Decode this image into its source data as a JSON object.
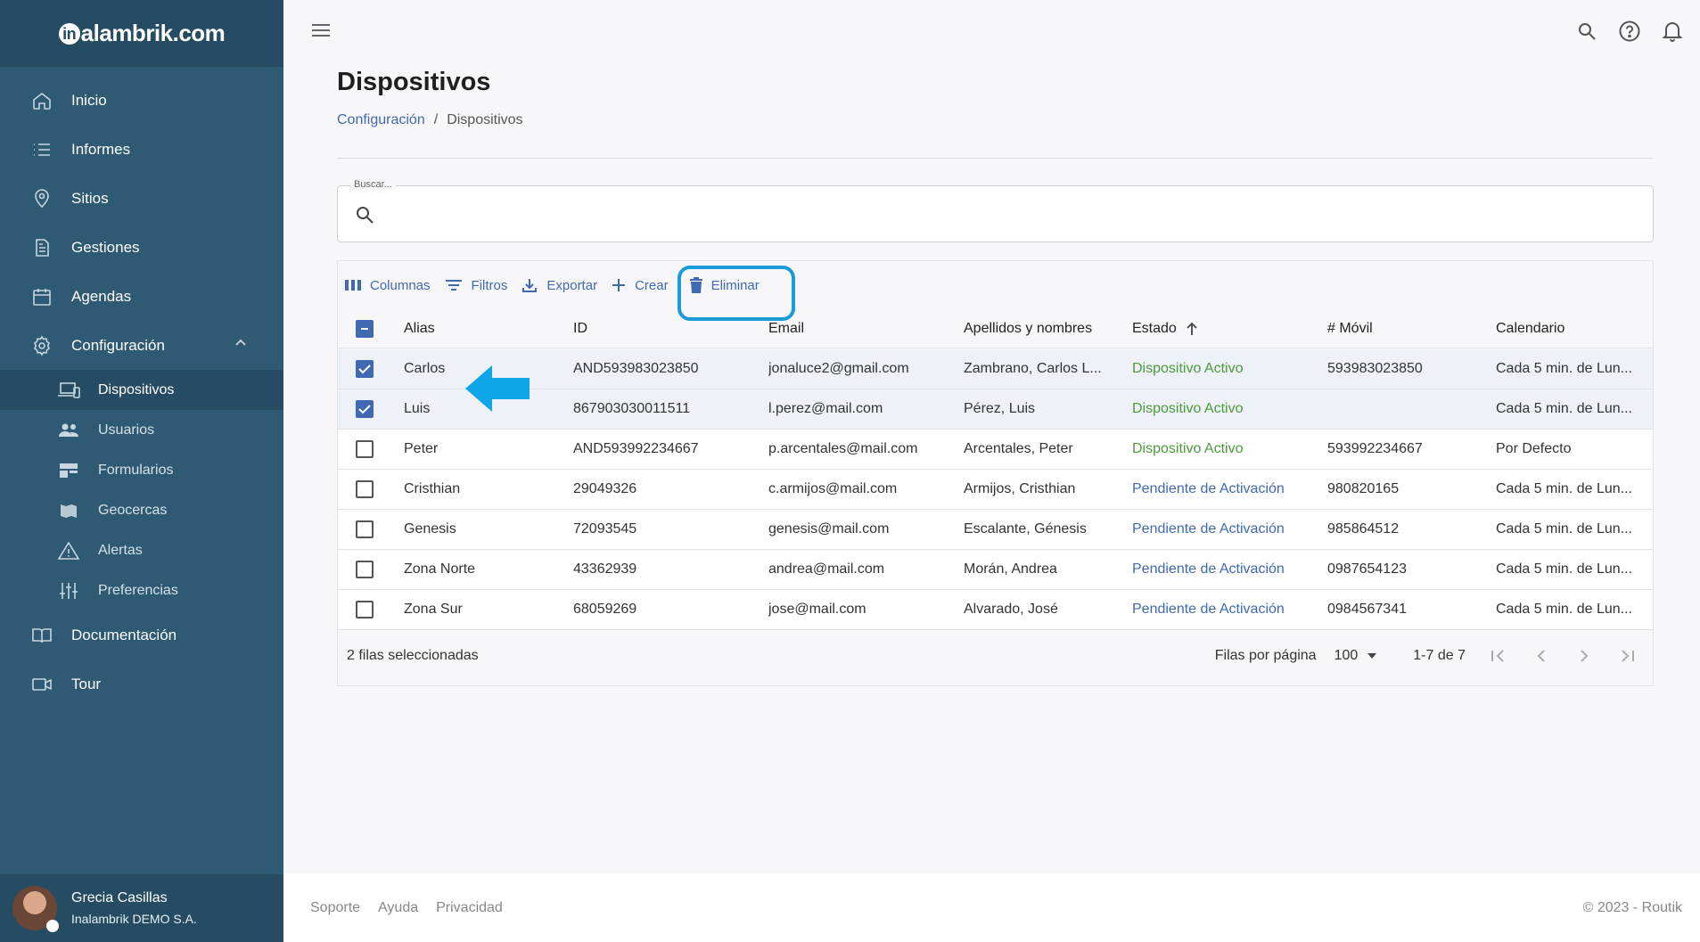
{
  "brand": {
    "logo_prefix": "in",
    "logo_text": "alambrik.com"
  },
  "sidebar": {
    "items": [
      {
        "label": "Inicio",
        "icon": "home-icon"
      },
      {
        "label": "Informes",
        "icon": "list-icon"
      },
      {
        "label": "Sitios",
        "icon": "location-pin-icon"
      },
      {
        "label": "Gestiones",
        "icon": "document-icon"
      },
      {
        "label": "Agendas",
        "icon": "calendar-icon"
      },
      {
        "label": "Configuración",
        "icon": "gear-icon"
      }
    ],
    "sub_items": [
      {
        "label": "Dispositivos",
        "icon": "devices-icon",
        "active": true
      },
      {
        "label": "Usuarios",
        "icon": "users-icon"
      },
      {
        "label": "Formularios",
        "icon": "form-icon"
      },
      {
        "label": "Geocercas",
        "icon": "map-icon"
      },
      {
        "label": "Alertas",
        "icon": "warning-icon"
      },
      {
        "label": "Preferencias",
        "icon": "sliders-icon"
      }
    ],
    "bottom_items": [
      {
        "label": "Documentación",
        "icon": "book-icon"
      },
      {
        "label": "Tour",
        "icon": "video-icon"
      }
    ],
    "user": {
      "name": "Grecia Casillas",
      "org": "Inalambrik DEMO S.A."
    }
  },
  "page": {
    "title": "Dispositivos",
    "breadcrumb": {
      "parent": "Configuración",
      "separator": "/",
      "current": "Dispositivos"
    }
  },
  "search": {
    "label": "Buscar...",
    "value": ""
  },
  "toolbar": {
    "columns": "Columnas",
    "filters": "Filtros",
    "export": "Exportar",
    "create": "Crear",
    "delete": "Eliminar"
  },
  "table": {
    "headers": {
      "alias": "Alias",
      "id": "ID",
      "email": "Email",
      "name": "Apellidos y nombres",
      "status": "Estado",
      "mobile": "# Móvil",
      "calendar": "Calendario"
    },
    "rows": [
      {
        "selected": true,
        "alias": "Carlos",
        "id": "AND593983023850",
        "email": "jonaluce2@gmail.com",
        "name": "Zambrano, Carlos L...",
        "status": "Dispositivo Activo",
        "status_type": "active",
        "mobile": "593983023850",
        "calendar": "Cada 5 min. de Lun..."
      },
      {
        "selected": true,
        "alias": "Luis",
        "id": "867903030011511",
        "email": "l.perez@mail.com",
        "name": "Pérez, Luis",
        "status": "Dispositivo Activo",
        "status_type": "active",
        "mobile": "",
        "calendar": "Cada 5 min. de Lun..."
      },
      {
        "selected": false,
        "alias": "Peter",
        "id": "AND593992234667",
        "email": "p.arcentales@mail.com",
        "name": "Arcentales, Peter",
        "status": "Dispositivo Activo",
        "status_type": "active",
        "mobile": "593992234667",
        "calendar": "Por Defecto"
      },
      {
        "selected": false,
        "alias": "Cristhian",
        "id": "29049326",
        "email": "c.armijos@mail.com",
        "name": "Armijos, Cristhian",
        "status": "Pendiente de Activación",
        "status_type": "pending",
        "mobile": "980820165",
        "calendar": "Cada 5 min. de Lun..."
      },
      {
        "selected": false,
        "alias": "Genesis",
        "id": "72093545",
        "email": "genesis@mail.com",
        "name": "Escalante, Génesis",
        "status": "Pendiente de Activación",
        "status_type": "pending",
        "mobile": "985864512",
        "calendar": "Cada 5 min. de Lun..."
      },
      {
        "selected": false,
        "alias": "Zona Norte",
        "id": "43362939",
        "email": "andrea@mail.com",
        "name": "Morán, Andrea",
        "status": "Pendiente de Activación",
        "status_type": "pending",
        "mobile": "0987654123",
        "calendar": "Cada 5 min. de Lun..."
      },
      {
        "selected": false,
        "alias": "Zona Sur",
        "id": "68059269",
        "email": "jose@mail.com",
        "name": "Alvarado, José",
        "status": "Pendiente de Activación",
        "status_type": "pending",
        "mobile": "0984567341",
        "calendar": "Cada 5 min. de Lun..."
      }
    ],
    "footer": {
      "selected_count": "2 filas seleccionadas",
      "rows_per_page_label": "Filas por página",
      "rows_per_page": "100",
      "range": "1-7 de 7"
    }
  },
  "footer": {
    "links": [
      "Soporte",
      "Ayuda",
      "Privacidad"
    ],
    "copyright": "© 2023 - Routik"
  },
  "colors": {
    "sidebar": "#2f5a73",
    "sidebar_dark": "#264c63",
    "accent": "#3f6ab1",
    "active_status": "#4c9a3a",
    "highlight": "#1a9ad7"
  }
}
